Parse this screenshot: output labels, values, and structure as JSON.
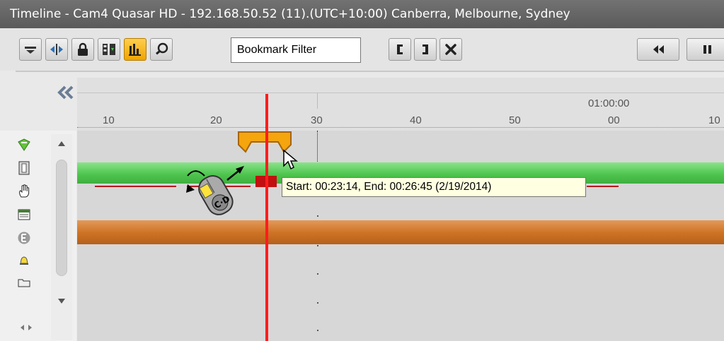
{
  "window": {
    "title": "Timeline - Cam4 Quasar HD - 192.168.50.52 (11).(UTC+10:00) Canberra, Melbourne, Sydney"
  },
  "toolbar": {
    "left_icons": [
      "menu-icon",
      "split-view-icon",
      "lock-icon",
      "export-icon",
      "bar-chart-icon",
      "search-map-icon"
    ],
    "active_icon": "bar-chart-icon",
    "bookmark_filter": {
      "value": "Bookmark Filter"
    },
    "marker_icons": [
      "mark-in-icon",
      "mark-out-icon",
      "clear-marks-icon"
    ],
    "playback_icons": [
      "rewind-icon",
      "pause-icon"
    ]
  },
  "side_tools": [
    "bookmark-add-icon",
    "film-icon",
    "hand-pan-icon",
    "grid-view-icon",
    "e-badge-icon",
    "alarm-bell-icon",
    "folder-icon"
  ],
  "ruler": {
    "hour_label": "01:00:00",
    "minute_labels": [
      "10",
      "20",
      "30",
      "40",
      "50",
      "00",
      "10"
    ]
  },
  "tooltip": {
    "text": "Start: 00:23:14, End: 00:26:45 (2/19/2014)"
  },
  "colors": {
    "titlebar": "#646464",
    "recording_track": "#4fc64f",
    "motion_track": "#cf7426",
    "bookmark": "#f5a50d",
    "playhead": "#ff1c1c",
    "active_button": "#f5b400"
  }
}
